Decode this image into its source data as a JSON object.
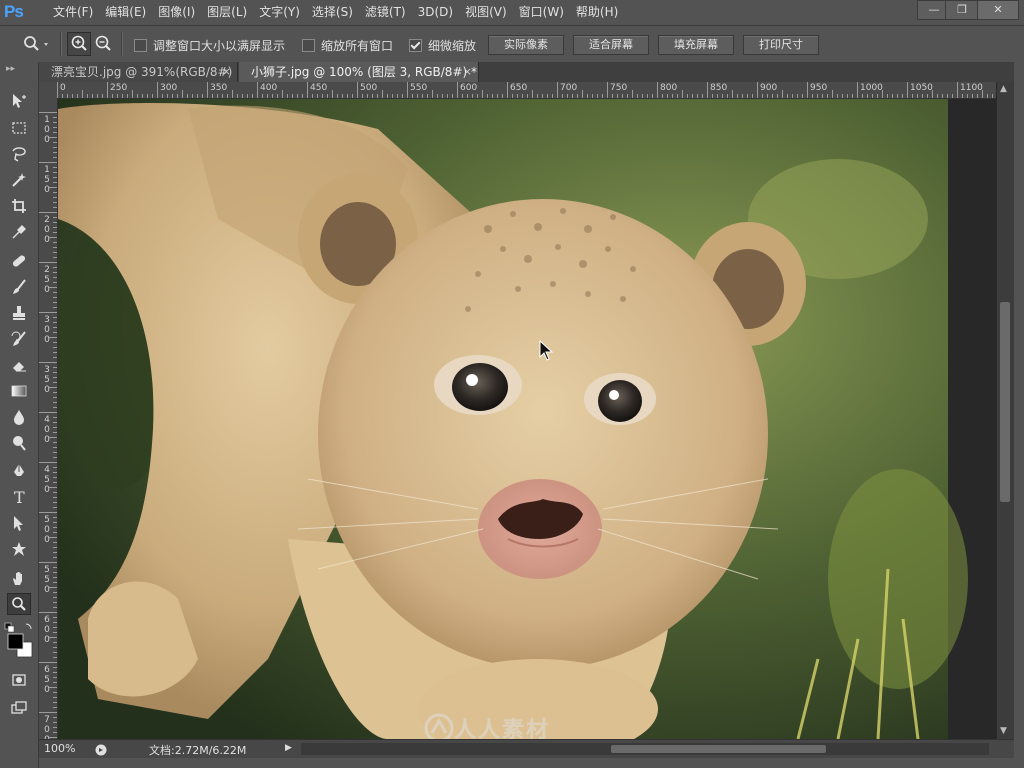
{
  "app": {
    "logo": "Ps"
  },
  "menubar": {
    "items": [
      "文件(F)",
      "编辑(E)",
      "图像(I)",
      "图层(L)",
      "文字(Y)",
      "选择(S)",
      "滤镜(T)",
      "3D(D)",
      "视图(V)",
      "窗口(W)",
      "帮助(H)"
    ]
  },
  "window_controls": {
    "minimize": "—",
    "restore": "❐",
    "close": "✕"
  },
  "options_bar": {
    "tool_icon": "zoom-icon",
    "checkboxes": [
      {
        "label": "调整窗口大小以满屏显示",
        "checked": false
      },
      {
        "label": "缩放所有窗口",
        "checked": false
      },
      {
        "label": "细微缩放",
        "checked": true
      }
    ],
    "buttons": [
      "实际像素",
      "适合屏幕",
      "填充屏幕",
      "打印尺寸"
    ]
  },
  "tabs": [
    {
      "label": "漂亮宝贝.jpg @ 391%(RGB/8#)",
      "close": "×",
      "active": false
    },
    {
      "label": "小狮子.jpg @ 100% (图层 3, RGB/8#) *",
      "close": "×",
      "active": true
    }
  ],
  "ruler": {
    "h_labels": [
      "0",
      "250",
      "300",
      "350",
      "400",
      "450",
      "500",
      "550",
      "600",
      "650",
      "700",
      "750",
      "800",
      "850",
      "900",
      "950",
      "1000",
      "1050",
      "1100"
    ],
    "v_labels": [
      "1\n0\n0",
      "1\n5\n0",
      "2\n0\n0",
      "2\n5\n0",
      "3\n0\n0",
      "3\n5\n0",
      "4\n0\n0",
      "4\n5\n0",
      "5\n0\n0",
      "5\n5\n0",
      "6\n0\n0",
      "6\n5\n0",
      "7\n0\n0"
    ]
  },
  "status": {
    "zoom": "100%",
    "doc_info": "文档:2.72M/6.22M",
    "arrow": "▶"
  },
  "watermark": {
    "text": "人人素材"
  },
  "colors": {
    "ui_bg": "#535353",
    "canvas_bg": "#282828",
    "accent": "#4aa3ff"
  }
}
